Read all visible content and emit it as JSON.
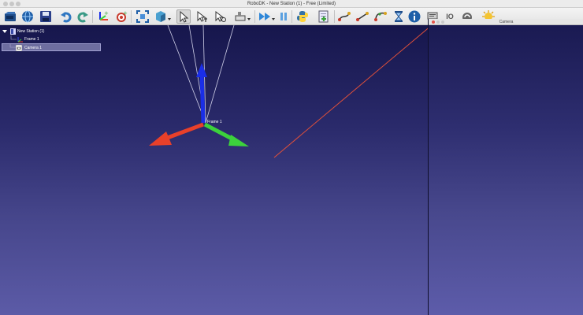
{
  "window": {
    "title": "RoboDK - New Station (1) - Free (Limited)"
  },
  "toolbar": {
    "items": [
      {
        "icon": "open-folder-icon",
        "label": "Open"
      },
      {
        "icon": "globe-icon",
        "label": "Open online library"
      },
      {
        "icon": "save-icon",
        "label": "Save"
      },
      {
        "icon": "undo-icon",
        "label": "Undo"
      },
      {
        "icon": "redo-icon",
        "label": "Redo"
      },
      {
        "icon": "add-reference-frame-icon",
        "label": "Add reference frame"
      },
      {
        "icon": "add-target-icon",
        "label": "Add target"
      },
      {
        "icon": "fit-all-icon",
        "label": "Fit all"
      },
      {
        "icon": "view-cube-icon",
        "label": "View"
      },
      {
        "icon": "select-pointer-icon",
        "label": "Select"
      },
      {
        "icon": "move-pointer-icon",
        "label": "Move reference"
      },
      {
        "icon": "rotate-pointer-icon",
        "label": "Rotate reference"
      },
      {
        "icon": "measure-tool-icon",
        "label": "Tools"
      },
      {
        "icon": "fast-forward-icon",
        "label": "Fast simulation"
      },
      {
        "icon": "pause-icon",
        "label": "Pause"
      },
      {
        "icon": "python-icon",
        "label": "Add Python program"
      },
      {
        "icon": "add-program-icon",
        "label": "Add program"
      },
      {
        "icon": "move-joint-icon",
        "label": "Move joint instruction"
      },
      {
        "icon": "move-linear-icon",
        "label": "Move linear instruction"
      },
      {
        "icon": "move-circular-icon",
        "label": "Move circular instruction"
      },
      {
        "icon": "hourglass-icon",
        "label": "Pause instruction"
      },
      {
        "icon": "display-message-icon",
        "label": "Show message"
      },
      {
        "icon": "io-icon",
        "label": "IO"
      },
      {
        "icon": "call-program-icon",
        "label": "Call program"
      },
      {
        "icon": "event-icon",
        "label": "Event"
      },
      {
        "icon": "info-icon",
        "label": "Information"
      }
    ],
    "io_label": "IO",
    "colors": {
      "blue": "#1f5fa8",
      "red": "#c83a2c",
      "yellow": "#d8a320",
      "green": "#3aa23a"
    }
  },
  "tree": {
    "items": [
      {
        "label": "New Station (1)",
        "icon": "station-icon",
        "expanded": true
      },
      {
        "label": "Frame 1",
        "icon": "frame-icon"
      },
      {
        "label": "Camera 1",
        "icon": "camera-icon",
        "selected": true
      }
    ]
  },
  "scene": {
    "frame_label": "Frame 1",
    "axis_colors": {
      "x": "#e8402a",
      "y": "#3cd23c",
      "z": "#1a2ee8"
    },
    "camera_ray_color": "#e0503a"
  },
  "camera_window": {
    "title": "Camera"
  }
}
